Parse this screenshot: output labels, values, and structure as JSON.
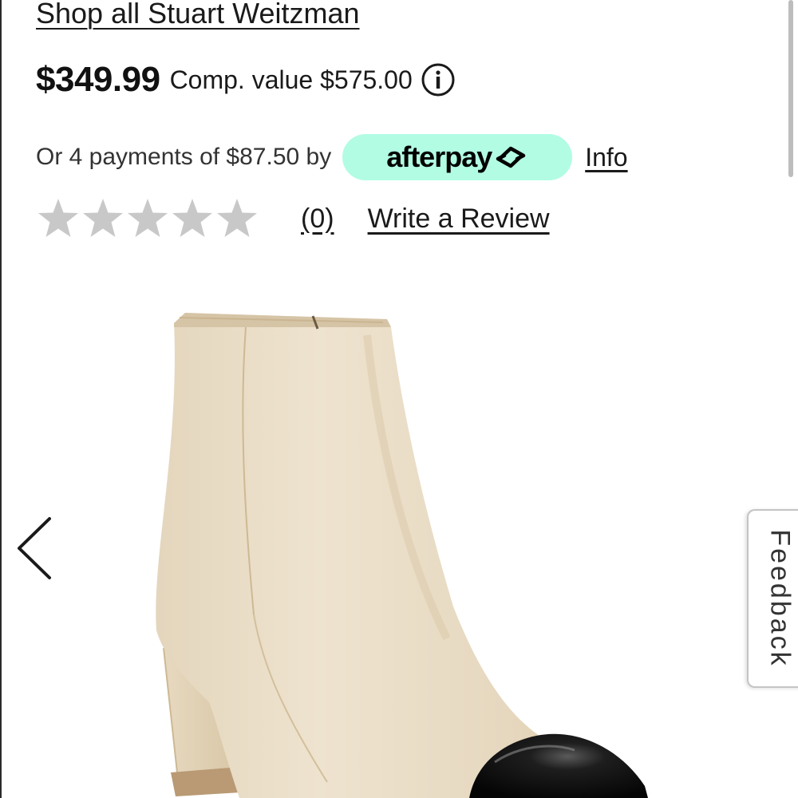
{
  "product": {
    "shop_all_label": "Shop all Stuart Weitzman",
    "price": "$349.99",
    "comp_value": "Comp. value $575.00",
    "info_icon": "info-circle-icon"
  },
  "payment": {
    "text": "Or 4 payments of $87.50 by",
    "provider": "afterpay",
    "provider_logo_icon": "afterpay-arrows-icon",
    "badge_color": "#b2fce4",
    "info_label": "Info"
  },
  "rating": {
    "stars_total": 5,
    "stars_filled": 0,
    "star_color": "#c8c8c8",
    "count_label": "(0)",
    "write_review_label": "Write a Review"
  },
  "gallery": {
    "prev_icon": "chevron-left-icon",
    "image_icon": "ankle-boot-image"
  },
  "feedback": {
    "label": "Feedback"
  }
}
